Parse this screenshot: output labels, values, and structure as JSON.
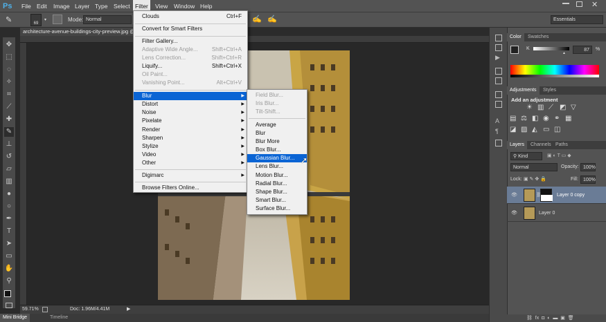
{
  "app": {
    "logo": "Ps"
  },
  "menubar": [
    "File",
    "Edit",
    "Image",
    "Layer",
    "Type",
    "Select",
    "Filter",
    "View",
    "Window",
    "Help"
  ],
  "options": {
    "brush_size": "69",
    "mode_label": "Mode:",
    "mode_value": "Normal",
    "workspace": "Essentials"
  },
  "document": {
    "tab_title": "architecture-avenue-buildings-city-preview.jpg @ ...",
    "zoom": "59.71%",
    "doc_info": "Doc: 1.96M/4.41M"
  },
  "bottom_tabs": [
    "Mini Bridge",
    "Timeline"
  ],
  "filter_menu": {
    "items": [
      {
        "label": "Clouds",
        "shortcut": "Ctrl+F"
      },
      {
        "label": "Convert for Smart Filters"
      },
      {
        "label": "Filter Gallery..."
      },
      {
        "label": "Adaptive Wide Angle...",
        "shortcut": "Shift+Ctrl+A",
        "disabled": true
      },
      {
        "label": "Lens Correction...",
        "shortcut": "Shift+Ctrl+R",
        "disabled": true
      },
      {
        "label": "Liquify...",
        "shortcut": "Shift+Ctrl+X"
      },
      {
        "label": "Oil Paint...",
        "disabled": true
      },
      {
        "label": "Vanishing Point...",
        "shortcut": "Alt+Ctrl+V",
        "disabled": true
      },
      {
        "label": "Blur",
        "submenu": true,
        "highlighted": true
      },
      {
        "label": "Distort",
        "submenu": true
      },
      {
        "label": "Noise",
        "submenu": true
      },
      {
        "label": "Pixelate",
        "submenu": true
      },
      {
        "label": "Render",
        "submenu": true
      },
      {
        "label": "Sharpen",
        "submenu": true
      },
      {
        "label": "Stylize",
        "submenu": true
      },
      {
        "label": "Video",
        "submenu": true
      },
      {
        "label": "Other",
        "submenu": true
      },
      {
        "label": "Digimarc",
        "submenu": true
      },
      {
        "label": "Browse Filters Online..."
      }
    ]
  },
  "blur_menu": {
    "items": [
      {
        "label": "Field Blur...",
        "disabled": true
      },
      {
        "label": "Iris Blur...",
        "disabled": true
      },
      {
        "label": "Tilt-Shift...",
        "disabled": true
      },
      {
        "label": "Average"
      },
      {
        "label": "Blur"
      },
      {
        "label": "Blur More"
      },
      {
        "label": "Box Blur..."
      },
      {
        "label": "Gaussian Blur...",
        "highlighted": true
      },
      {
        "label": "Lens Blur..."
      },
      {
        "label": "Motion Blur..."
      },
      {
        "label": "Radial Blur..."
      },
      {
        "label": "Shape Blur..."
      },
      {
        "label": "Smart Blur..."
      },
      {
        "label": "Surface Blur..."
      }
    ]
  },
  "color_panel": {
    "tabs": [
      "Color",
      "Swatches"
    ],
    "channel": "K",
    "value": "87",
    "unit": "%"
  },
  "adjustments_panel": {
    "tabs": [
      "Adjustments",
      "Styles"
    ],
    "heading": "Add an adjustment"
  },
  "layers_panel": {
    "tabs": [
      "Layers",
      "Channels",
      "Paths"
    ],
    "kind": "Kind",
    "blend_mode": "Normal",
    "opacity_label": "Opacity:",
    "opacity": "100%",
    "lock_label": "Lock:",
    "fill_label": "Fill:",
    "fill": "100%",
    "layers": [
      {
        "name": "Layer 0 copy",
        "selected": true
      },
      {
        "name": "Layer 0"
      }
    ]
  },
  "colors": {
    "menu_highlight": "#0a64d4",
    "ps_blue": "#4fb0e8"
  }
}
